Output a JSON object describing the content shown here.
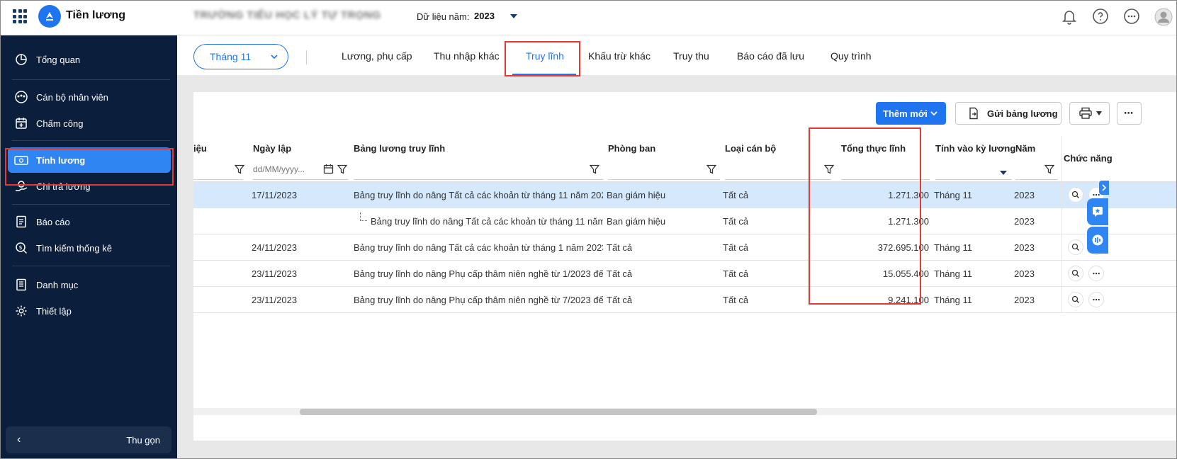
{
  "app": {
    "title": "Tiền lương",
    "school_name": "TRƯỜNG TIỂU HỌC LÝ TỰ TRỌNG",
    "year_label": "Dữ liệu năm:",
    "year_value": "2023"
  },
  "sidebar": {
    "items": [
      {
        "label": "Tổng quan",
        "icon": "pie-chart-icon"
      },
      {
        "label": "Cán bộ nhân viên",
        "icon": "team-icon"
      },
      {
        "label": "Chấm công",
        "icon": "calendar-plus-icon"
      },
      {
        "label": "Tính lương",
        "icon": "money-icon"
      },
      {
        "label": "Chi trả lương",
        "icon": "pay-icon"
      },
      {
        "label": "Báo cáo",
        "icon": "report-icon"
      },
      {
        "label": "Tìm kiếm thống kê",
        "icon": "search-dollar-icon"
      },
      {
        "label": "Danh mục",
        "icon": "list-icon"
      },
      {
        "label": "Thiết lập",
        "icon": "gear-icon"
      }
    ],
    "collapse_label": "Thu gọn"
  },
  "tabs": {
    "month": "Tháng 11",
    "items": [
      "Lương, phụ cấp",
      "Thu nhập khác",
      "Truy lĩnh",
      "Khấu trừ khác",
      "Truy thu",
      "Báo cáo đã lưu",
      "Quy trình"
    ],
    "active": "Truy lĩnh"
  },
  "toolbar": {
    "add_label": "Thêm mới",
    "send_label": "Gửi bảng lương"
  },
  "table": {
    "headers": {
      "partial": "iệu",
      "date": "Ngày lập",
      "name": "Bảng lương truy lĩnh",
      "dept": "Phòng ban",
      "type": "Loại cán bộ",
      "total": "Tổng thực lĩnh",
      "period": "Tính vào kỳ lương",
      "year": "Năm",
      "actions": "Chức năng"
    },
    "date_placeholder": "dd/MM/yyyy...",
    "rows": [
      {
        "date": "17/11/2023",
        "name": "Bảng truy lĩnh do nâng Tất cả các khoản từ tháng 11 năm 202...",
        "dept": "Ban giám hiệu",
        "type": "Tất cả",
        "total": "1.271.300",
        "period": "Tháng 11",
        "year": "2023",
        "selected": true,
        "child": false
      },
      {
        "date": "",
        "name": "Bảng truy lĩnh do nâng Tất cả các khoản từ tháng 11 năm ...",
        "dept": "Ban giám hiệu",
        "type": "Tất cả",
        "total": "1.271.300",
        "period": "",
        "year": "2023",
        "selected": false,
        "child": true
      },
      {
        "date": "24/11/2023",
        "name": "Bảng truy lĩnh do nâng Tất cả các khoản từ tháng 1 năm 2023 ...",
        "dept": "Tất cả",
        "type": "Tất cả",
        "total": "372.695.100",
        "period": "Tháng 11",
        "year": "2023",
        "selected": false,
        "child": false
      },
      {
        "date": "23/11/2023",
        "name": "Bảng truy lĩnh do nâng Phụ cấp thâm niên nghề từ 1/2023 đến...",
        "dept": "Tất cả",
        "type": "Tất cả",
        "total": "15.055.400",
        "period": "Tháng 11",
        "year": "2023",
        "selected": false,
        "child": false
      },
      {
        "date": "23/11/2023",
        "name": "Bảng truy lĩnh do nâng Phụ cấp thâm niên nghề từ 7/2023 đến...",
        "dept": "Tất cả",
        "type": "Tất cả",
        "total": "9.241.100",
        "period": "Tháng 11",
        "year": "2023",
        "selected": false,
        "child": false
      }
    ]
  },
  "colors": {
    "primary": "#1f74f0",
    "sidebar_bg": "#0b1e3b",
    "highlight": "#e53935",
    "selected_row": "#d6e8fb"
  }
}
